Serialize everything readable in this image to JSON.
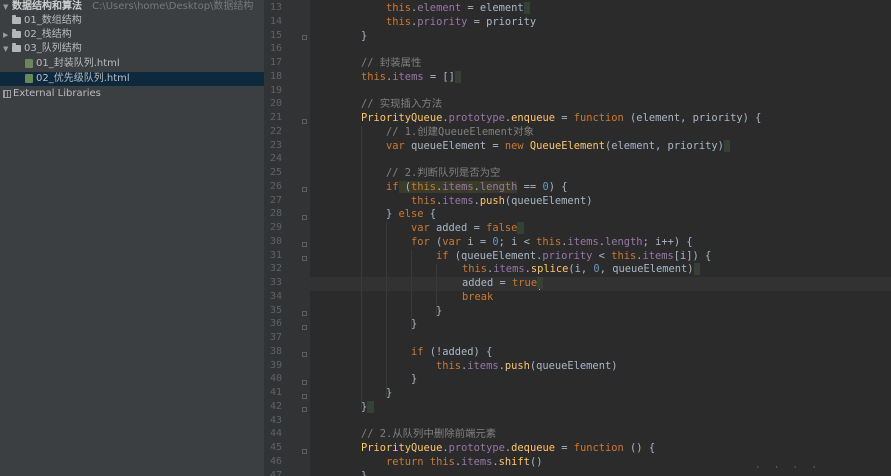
{
  "project_tree": {
    "root": {
      "name": "数据结构和算法",
      "path": "C:\\Users\\home\\Desktop\\数据结构"
    },
    "items": [
      {
        "label": "01_数组结构",
        "kind": "folder",
        "expanded": false
      },
      {
        "label": "02_栈结构",
        "kind": "folder",
        "expanded": false
      },
      {
        "label": "03_队列结构",
        "kind": "folder",
        "expanded": true
      },
      {
        "label": "01_封装队列.html",
        "kind": "file"
      },
      {
        "label": "02_优先级队列.html",
        "kind": "file",
        "selected": true
      },
      {
        "label": "External Libraries",
        "kind": "library"
      }
    ]
  },
  "editor": {
    "line_numbers": [
      "13",
      "14",
      "15",
      "16",
      "17",
      "18",
      "19",
      "20",
      "21",
      "22",
      "23",
      "24",
      "25",
      "26",
      "27",
      "28",
      "29",
      "30",
      "31",
      "32",
      "33",
      "34",
      "35",
      "36",
      "37",
      "38",
      "39",
      "40",
      "41",
      "42",
      "43",
      "44",
      "45",
      "46",
      "47"
    ],
    "lines": [
      [
        {
          "t": "this",
          "c": "kw"
        },
        {
          "t": ".",
          "c": "df"
        },
        {
          "t": "element",
          "c": "prop"
        },
        {
          "t": " = element",
          "c": "df"
        }
      ],
      [
        {
          "t": "this",
          "c": "kw"
        },
        {
          "t": ".",
          "c": "df"
        },
        {
          "t": "priority",
          "c": "prop"
        },
        {
          "t": " = priority",
          "c": "df"
        }
      ],
      [
        {
          "t": "}",
          "c": "df"
        }
      ],
      [],
      [
        {
          "t": "// 封装属性",
          "c": "cm"
        }
      ],
      [
        {
          "t": "this",
          "c": "kw"
        },
        {
          "t": ".",
          "c": "df"
        },
        {
          "t": "items",
          "c": "prop"
        },
        {
          "t": " = []",
          "c": "df"
        }
      ],
      [],
      [
        {
          "t": "// 实现插入方法",
          "c": "cm"
        }
      ],
      [
        {
          "t": "PriorityQueue",
          "c": "cls"
        },
        {
          "t": ".",
          "c": "df"
        },
        {
          "t": "prototype",
          "c": "prop"
        },
        {
          "t": ".",
          "c": "df"
        },
        {
          "t": "enqueue",
          "c": "fn"
        },
        {
          "t": " = ",
          "c": "df"
        },
        {
          "t": "function",
          "c": "kw"
        },
        {
          "t": " (element, priority) {",
          "c": "df"
        }
      ],
      [
        {
          "t": "// 1.创建QueueElement对象",
          "c": "cm"
        }
      ],
      [
        {
          "t": "var",
          "c": "kw"
        },
        {
          "t": " queueElement = ",
          "c": "df"
        },
        {
          "t": "new",
          "c": "kw"
        },
        {
          "t": " ",
          "c": "df"
        },
        {
          "t": "QueueElement",
          "c": "cls"
        },
        {
          "t": "(element, priority)",
          "c": "df"
        }
      ],
      [],
      [
        {
          "t": "// 2.判断队列是否为空",
          "c": "cm"
        }
      ],
      [
        {
          "t": "if",
          "c": "kw"
        },
        {
          "t": " (",
          "c": "df"
        },
        {
          "t": "this",
          "c": "kw"
        },
        {
          "t": ".",
          "c": "df"
        },
        {
          "t": "items",
          "c": "prop"
        },
        {
          "t": ".",
          "c": "df"
        },
        {
          "t": "length",
          "c": "prop"
        },
        {
          "t": " == ",
          "c": "df"
        },
        {
          "t": "0",
          "c": "num"
        },
        {
          "t": ") {",
          "c": "df"
        }
      ],
      [
        {
          "t": "this",
          "c": "kw"
        },
        {
          "t": ".",
          "c": "df"
        },
        {
          "t": "items",
          "c": "prop"
        },
        {
          "t": ".",
          "c": "df"
        },
        {
          "t": "push",
          "c": "fn"
        },
        {
          "t": "(queueElement)",
          "c": "df"
        }
      ],
      [
        {
          "t": "} ",
          "c": "df"
        },
        {
          "t": "else",
          "c": "kw"
        },
        {
          "t": " {",
          "c": "df"
        }
      ],
      [
        {
          "t": "var",
          "c": "kw"
        },
        {
          "t": " added = ",
          "c": "df"
        },
        {
          "t": "false",
          "c": "kw"
        }
      ],
      [
        {
          "t": "for",
          "c": "kw"
        },
        {
          "t": " (",
          "c": "df"
        },
        {
          "t": "var",
          "c": "kw"
        },
        {
          "t": " i = ",
          "c": "df"
        },
        {
          "t": "0",
          "c": "num"
        },
        {
          "t": "; i < ",
          "c": "df"
        },
        {
          "t": "this",
          "c": "kw"
        },
        {
          "t": ".",
          "c": "df"
        },
        {
          "t": "items",
          "c": "prop"
        },
        {
          "t": ".",
          "c": "df"
        },
        {
          "t": "length",
          "c": "prop"
        },
        {
          "t": "; i++) {",
          "c": "df"
        }
      ],
      [
        {
          "t": "if",
          "c": "kw"
        },
        {
          "t": " (queueElement.",
          "c": "df"
        },
        {
          "t": "priority",
          "c": "prop"
        },
        {
          "t": " < ",
          "c": "df"
        },
        {
          "t": "this",
          "c": "kw"
        },
        {
          "t": ".",
          "c": "df"
        },
        {
          "t": "items",
          "c": "prop"
        },
        {
          "t": "[i]) {",
          "c": "df"
        }
      ],
      [
        {
          "t": "this",
          "c": "kw"
        },
        {
          "t": ".",
          "c": "df"
        },
        {
          "t": "items",
          "c": "prop"
        },
        {
          "t": ".",
          "c": "df"
        },
        {
          "t": "splice",
          "c": "fn"
        },
        {
          "t": "(i, ",
          "c": "df"
        },
        {
          "t": "0",
          "c": "num"
        },
        {
          "t": ", queueElement)",
          "c": "df"
        }
      ],
      [
        {
          "t": "added = ",
          "c": "df"
        },
        {
          "t": "true",
          "c": "kw"
        }
      ],
      [
        {
          "t": "break",
          "c": "kw"
        }
      ],
      [
        {
          "t": "}",
          "c": "df"
        }
      ],
      [
        {
          "t": "}",
          "c": "df"
        }
      ],
      [],
      [
        {
          "t": "if",
          "c": "kw"
        },
        {
          "t": " (!added) {",
          "c": "df"
        }
      ],
      [
        {
          "t": "this",
          "c": "kw"
        },
        {
          "t": ".",
          "c": "df"
        },
        {
          "t": "items",
          "c": "prop"
        },
        {
          "t": ".",
          "c": "df"
        },
        {
          "t": "push",
          "c": "fn"
        },
        {
          "t": "(queueElement)",
          "c": "df"
        }
      ],
      [
        {
          "t": "}",
          "c": "df"
        }
      ],
      [
        {
          "t": "}",
          "c": "df"
        }
      ],
      [
        {
          "t": "}",
          "c": "df"
        }
      ],
      [],
      [
        {
          "t": "// 2.从队列中删除前端元素",
          "c": "cm"
        }
      ],
      [
        {
          "t": "PriorityQueue",
          "c": "cls"
        },
        {
          "t": ".",
          "c": "df"
        },
        {
          "t": "prototype",
          "c": "prop"
        },
        {
          "t": ".",
          "c": "df"
        },
        {
          "t": "dequeue",
          "c": "fn"
        },
        {
          "t": " = ",
          "c": "df"
        },
        {
          "t": "function",
          "c": "kw"
        },
        {
          "t": " () {",
          "c": "df"
        }
      ],
      [
        {
          "t": "return",
          "c": "kw"
        },
        {
          "t": " ",
          "c": "df"
        },
        {
          "t": "this",
          "c": "kw"
        },
        {
          "t": ".",
          "c": "df"
        },
        {
          "t": "items",
          "c": "prop"
        },
        {
          "t": ".",
          "c": "df"
        },
        {
          "t": "shift",
          "c": "fn"
        },
        {
          "t": "()",
          "c": "df"
        }
      ],
      [
        {
          "t": "}",
          "c": "df"
        }
      ]
    ]
  }
}
